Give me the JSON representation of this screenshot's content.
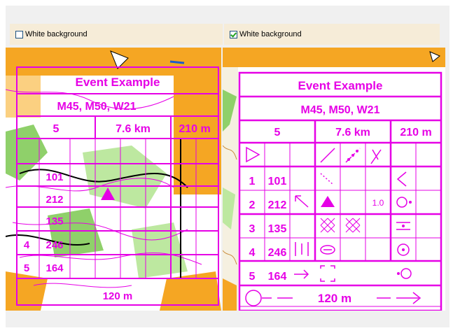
{
  "left_option": {
    "label": "White background",
    "checked": false
  },
  "right_option": {
    "label": "White background",
    "checked": true
  },
  "card": {
    "title": "Event Example",
    "classes": "M45, M50, W21",
    "course": "5",
    "length": "7.6 km",
    "climb": "210 m",
    "controls": [
      {
        "num": "1",
        "code": "101"
      },
      {
        "num": "2",
        "code": "212"
      },
      {
        "num": "3",
        "code": "135"
      },
      {
        "num": "4",
        "code": "246"
      },
      {
        "num": "5",
        "code": "164"
      }
    ],
    "dimension": "1.0",
    "finish": "120 m"
  },
  "colors": {
    "purple": "#e600e6",
    "map_yellow": "#f5a623",
    "map_green": "#8fd06a",
    "map_brown": "#c88a3a"
  }
}
